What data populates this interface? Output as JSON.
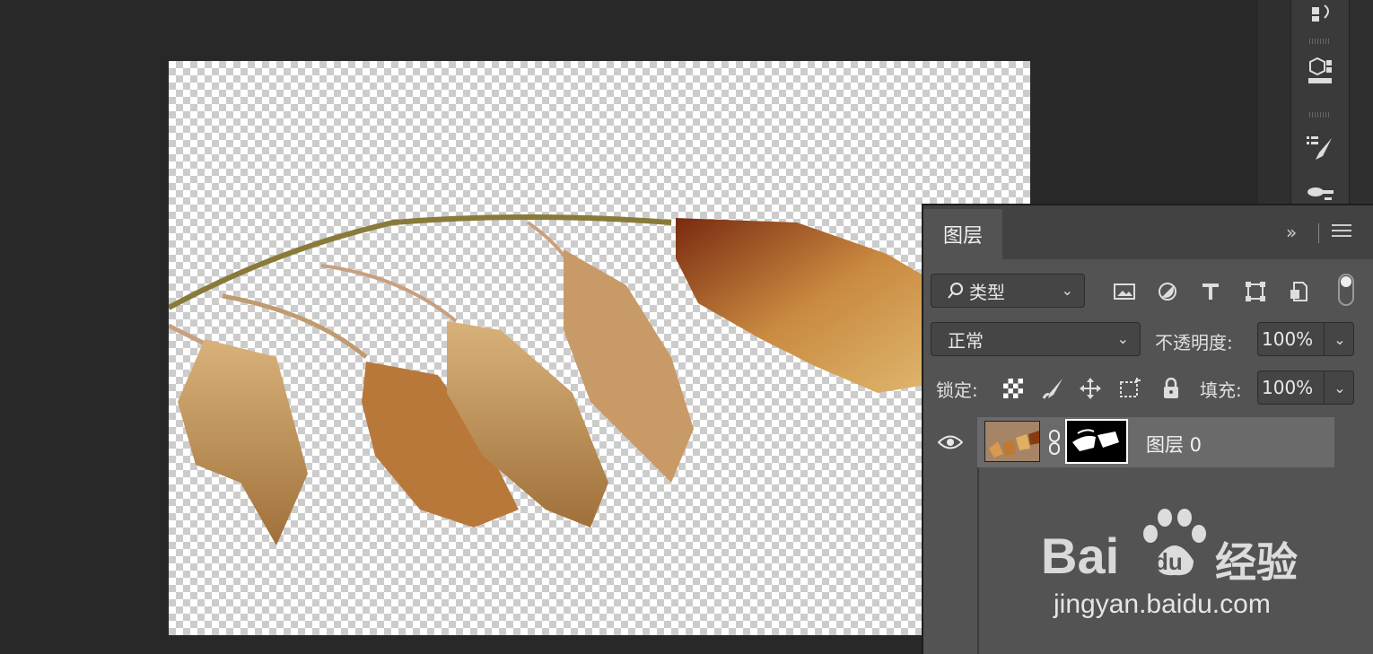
{
  "panel": {
    "tab_label": "图层",
    "collapse_glyph": "»",
    "filter": {
      "label": "类型"
    },
    "blend_mode": "正常",
    "opacity_label": "不透明度:",
    "opacity_value": "100%",
    "lock_label": "锁定:",
    "fill_label": "填充:",
    "fill_value": "100%",
    "layers": [
      {
        "name": "图层 0",
        "visible": true,
        "has_mask": true
      }
    ]
  },
  "watermark": {
    "brand": "Bai",
    "brand2": "du",
    "cn": "经验",
    "url": "jingyan.baidu.com"
  },
  "colors": {
    "panel_bg": "#535353",
    "workspace_bg": "#282828",
    "selected_row": "#6a6a6a"
  }
}
